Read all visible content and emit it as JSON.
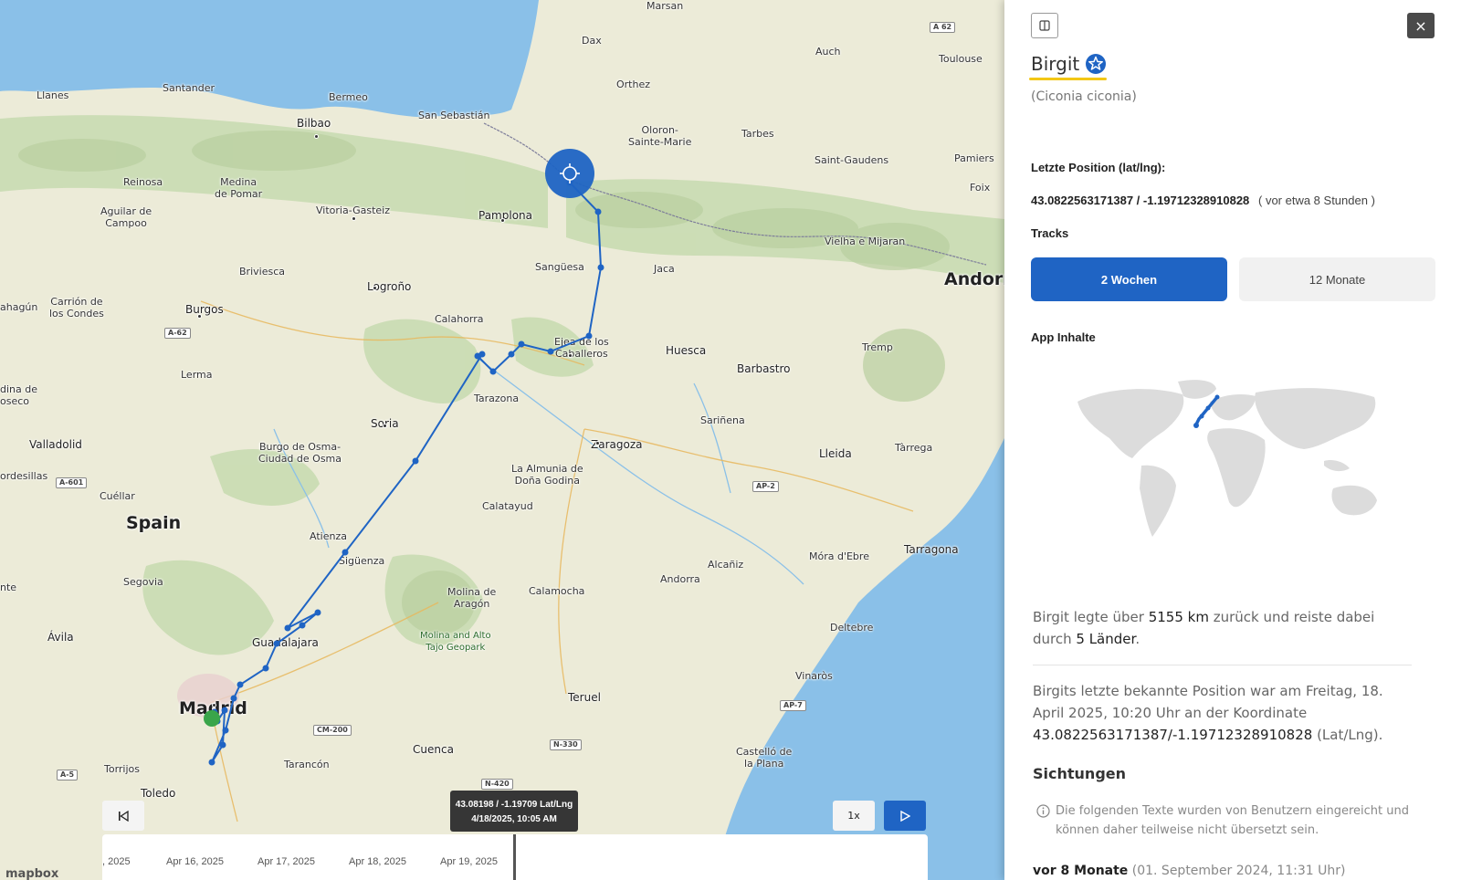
{
  "map": {
    "labels": [
      {
        "text": "Marsan"
      },
      {
        "text": "A 62"
      },
      {
        "text": "Dax"
      },
      {
        "text": "Auch"
      },
      {
        "text": "Toulouse"
      },
      {
        "text": "Orthez"
      },
      {
        "text": "Santander"
      },
      {
        "text": "Llanes"
      },
      {
        "text": "Bermeo"
      },
      {
        "text": "San Sebastián"
      },
      {
        "text": "Bilbao"
      },
      {
        "text": "Oloron-\nSainte-Marie"
      },
      {
        "text": "Tarbes"
      },
      {
        "text": "Pamiers"
      },
      {
        "text": "Reinosa"
      },
      {
        "text": "Medina\nde Pomar"
      },
      {
        "text": "Aguilar de\nCampoo"
      },
      {
        "text": "Vitoria-Gasteiz"
      },
      {
        "text": "Pamplona"
      },
      {
        "text": "Saint-Gaudens"
      },
      {
        "text": "Foix"
      },
      {
        "text": "Vielha e Mijaran"
      },
      {
        "text": "Briviesca"
      },
      {
        "text": "Logroño"
      },
      {
        "text": "Sangüesa"
      },
      {
        "text": "Jaca"
      },
      {
        "text": "Andorra"
      },
      {
        "text": "ahagún"
      },
      {
        "text": "Carrión de\nlos Condes"
      },
      {
        "text": "Burgos"
      },
      {
        "text": "A-62"
      },
      {
        "text": "Calahorra"
      },
      {
        "text": "Ejea de los\nCaballeros"
      },
      {
        "text": "Huesca"
      },
      {
        "text": "Tremp"
      },
      {
        "text": "Lerma"
      },
      {
        "text": "Barbastro"
      },
      {
        "text": "dina de\noseco"
      },
      {
        "text": "Tarazona"
      },
      {
        "text": "Soria"
      },
      {
        "text": "Sariñena"
      },
      {
        "text": "Valladolid"
      },
      {
        "text": "Burgo de Osma-\nCiudad de Osma"
      },
      {
        "text": "Zaragoza"
      },
      {
        "text": "Lleida"
      },
      {
        "text": "Tàrrega"
      },
      {
        "text": "ordesillas"
      },
      {
        "text": "A-601"
      },
      {
        "text": "La Almunia de\nDoña Godina"
      },
      {
        "text": "AP-2"
      },
      {
        "text": "Cuéllar"
      },
      {
        "text": "Spain"
      },
      {
        "text": "Calatayud"
      },
      {
        "text": "Atienza"
      },
      {
        "text": "Tarragona"
      },
      {
        "text": "Sigüenza"
      },
      {
        "text": "Móra d'Ebre"
      },
      {
        "text": "Segovia"
      },
      {
        "text": "Molina de\nAragón"
      },
      {
        "text": "Calamocha"
      },
      {
        "text": "Alcañiz"
      },
      {
        "text": "Andorra"
      },
      {
        "text": "nte"
      },
      {
        "text": "Ávila"
      },
      {
        "text": "Guadalajara"
      },
      {
        "text": "Molina and Alto\nTajo Geopark"
      },
      {
        "text": "Deltebre"
      },
      {
        "text": "Madrid"
      },
      {
        "text": "Vinaròs"
      },
      {
        "text": "Teruel"
      },
      {
        "text": "AP-7"
      },
      {
        "text": "CM-200"
      },
      {
        "text": "N-330"
      },
      {
        "text": "Cuenca"
      },
      {
        "text": "Torrijos"
      },
      {
        "text": "A-5"
      },
      {
        "text": "Tarancón"
      },
      {
        "text": "Castelló de\nla Plana"
      },
      {
        "text": "N-420"
      },
      {
        "text": "Toledo"
      }
    ],
    "tooltip": {
      "line1": "43.08198 / -1.19709 Lat/Lng",
      "line2": "4/18/2025, 10:05 AM"
    },
    "controls": {
      "rewind_icon": "skip-back-icon",
      "speed_label": "1x",
      "play_icon": "play-icon"
    },
    "timeline": {
      "ticks": [
        ", 2025",
        "Apr 16, 2025",
        "Apr 17, 2025",
        "Apr 18, 2025",
        "Apr 19, 2025"
      ]
    },
    "logo": "mapbox",
    "track_color": "#1f64c4",
    "current_marker_icon": "crosshair-icon"
  },
  "panel": {
    "toggle_icon": "sidebar-toggle-icon",
    "close_label": "×",
    "name": "Birgit",
    "verified_icon": "verified-star-icon",
    "species": "(Ciconia ciconia)",
    "position_label": "Letzte Position (lat/lng):",
    "position_value": "43.0822563171387 / -1.19712328910828",
    "position_ago": "( vor etwa 8 Stunden )",
    "tracks_label": "Tracks",
    "tracks": [
      {
        "label": "2 Wochen",
        "active": true
      },
      {
        "label": "12 Monate",
        "active": false
      }
    ],
    "app_label": "App Inhalte",
    "summary": {
      "prefix": "Birgit legte über ",
      "distance": "5155 km",
      "middle": " zurück und reiste dabei durch ",
      "countries": "5 Länder",
      "suffix": "."
    },
    "position_text": {
      "prefix": "Birgits letzte bekannte Position war am Freitag, 18. April 2025, 10:20 Uhr an der Koordinate ",
      "coords": "43.0822563171387/-1.19712328910828",
      "suffix": " (Lat/Lng)."
    },
    "sightings_label": "Sichtungen",
    "notice": "Die folgenden Texte wurden von Benutzern eingereicht und können daher teilweise nicht übersetzt sein.",
    "entry": {
      "when": "vor 8 Monate",
      "date": "(01. September 2024, 11:31 Uhr)"
    }
  },
  "colors": {
    "accent": "#1f64c4",
    "highlight": "#f3c716",
    "sea": "#8ac0e8"
  }
}
